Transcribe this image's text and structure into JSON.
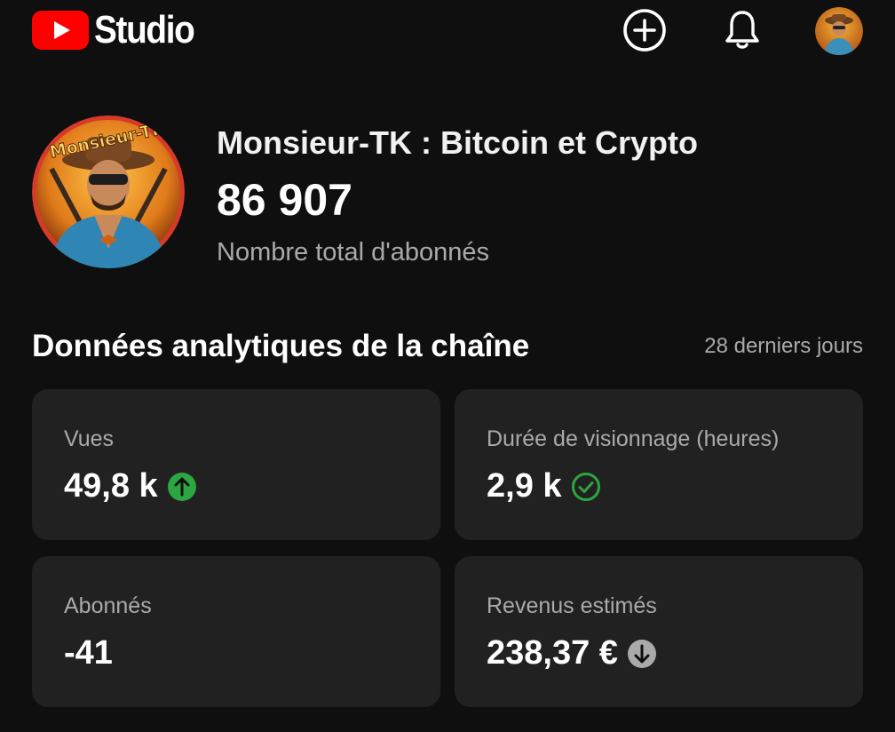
{
  "header": {
    "app_name": "Studio",
    "create_icon": "create-plus-icon",
    "notifications_icon": "bell-icon",
    "brand_color": "#ff0000"
  },
  "channel": {
    "name": "Monsieur-TK : Bitcoin et Crypto",
    "subscriber_count": "86 907",
    "subscriber_label": "Nombre total d'abonnés",
    "avatar_badge_text": "Monsieur-TK"
  },
  "analytics": {
    "title": "Données analytiques de la chaîne",
    "period": "28 derniers jours",
    "cards": [
      {
        "label": "Vues",
        "value": "49,8 k",
        "trend_icon": "arrow-up-circle-icon",
        "trend_color": "#2ba640"
      },
      {
        "label": "Durée de visionnage (heures)",
        "value": "2,9 k",
        "trend_icon": "check-circle-icon",
        "trend_color": "#2ba640"
      },
      {
        "label": "Abonnés",
        "value": "-41"
      },
      {
        "label": "Revenus estimés",
        "value": "238,37 €",
        "trend_icon": "arrow-down-circle-icon",
        "trend_color": "#aaaaaa"
      }
    ]
  }
}
